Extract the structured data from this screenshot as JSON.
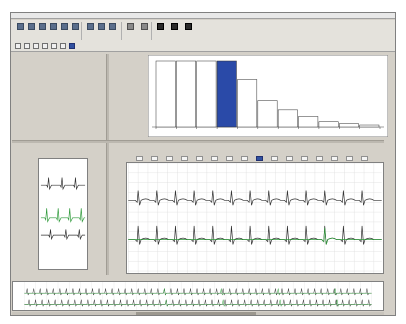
{
  "window": {
    "title": ""
  },
  "toolbar": {
    "buttons": [
      {
        "icon": "window-icon",
        "label": ""
      },
      {
        "icon": "record-icon",
        "label": ""
      },
      {
        "icon": "print-icon",
        "label": ""
      },
      {
        "icon": "export-icon",
        "label": ""
      },
      {
        "icon": "report-icon",
        "label": ""
      },
      {
        "icon": "edit-icon",
        "label": ""
      },
      {
        "icon": "zoom-icon",
        "label": ""
      },
      {
        "icon": "chart-icon",
        "label": ""
      },
      {
        "icon": "list-icon",
        "label": ""
      },
      {
        "icon": "table-icon",
        "label": ""
      },
      {
        "icon": "grid-icon",
        "label": ""
      },
      {
        "icon": "trash-icon",
        "label": ""
      },
      {
        "icon": "config-icon",
        "label": ""
      },
      {
        "icon": "help-icon",
        "label": ""
      }
    ],
    "small_controls": [
      {
        "icon": "mini-icon"
      },
      {
        "icon": "mini-icon"
      },
      {
        "icon": "mini-icon"
      },
      {
        "icon": "mini-icon"
      },
      {
        "icon": "mini-icon"
      },
      {
        "icon": "mini-icon"
      },
      {
        "icon": "marker-icon"
      }
    ]
  },
  "info_panel": {
    "lines": [
      "",
      ""
    ]
  },
  "histogram": {
    "label": "",
    "x_label": "",
    "bars": [
      {
        "value": 1.0,
        "selected": false
      },
      {
        "value": 1.0,
        "selected": false
      },
      {
        "value": 1.0,
        "selected": false
      },
      {
        "value": 1.0,
        "selected": true
      },
      {
        "value": 0.72,
        "selected": false
      },
      {
        "value": 0.4,
        "selected": false
      },
      {
        "value": 0.26,
        "selected": false
      },
      {
        "value": 0.16,
        "selected": false
      },
      {
        "value": 0.08,
        "selected": false
      },
      {
        "value": 0.05,
        "selected": false
      },
      {
        "value": 0.03,
        "selected": false
      }
    ],
    "selected_color": "#2a4aa8"
  },
  "beat_template": {
    "label": ""
  },
  "main_strip": {
    "left_caption": "",
    "center_caption": "",
    "right_caption": "",
    "nav_count": 16,
    "nav_selected": 8
  },
  "colors": {
    "ecg_trace": "#303030",
    "ecg_highlight": "#2e9a3a",
    "grid": "#dcdcdc",
    "accent": "#2a4aa8"
  }
}
